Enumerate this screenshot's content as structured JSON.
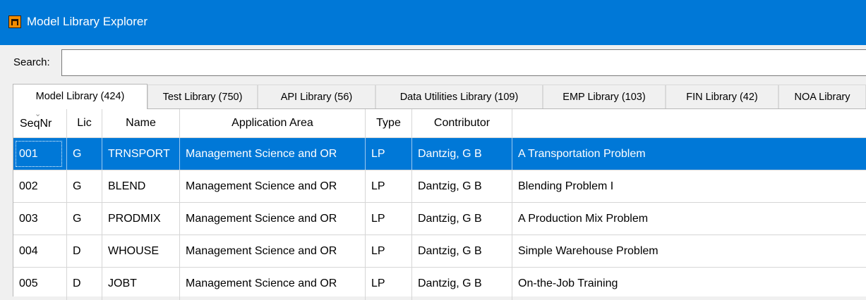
{
  "window": {
    "title": "Model Library Explorer"
  },
  "search": {
    "label": "Search:",
    "value": "",
    "placeholder": ""
  },
  "tabs": [
    {
      "label": "Model Library (424)",
      "active": true
    },
    {
      "label": "Test Library (750)",
      "active": false
    },
    {
      "label": "API Library (56)",
      "active": false
    },
    {
      "label": "Data Utilities Library (109)",
      "active": false
    },
    {
      "label": "EMP Library (103)",
      "active": false
    },
    {
      "label": "FIN Library (42)",
      "active": false
    },
    {
      "label": "NOA Library",
      "active": false
    }
  ],
  "table": {
    "sort_indicator": "chevron-down-icon",
    "columns": [
      "SeqNr",
      "Lic",
      "Name",
      "Application Area",
      "Type",
      "Contributor",
      ""
    ],
    "rows": [
      {
        "seqnr": "001",
        "lic": "G",
        "name": "TRNSPORT",
        "area": "Management Science and OR",
        "type": "LP",
        "contributor": "Dantzig, G B",
        "description": "A Transportation Problem",
        "selected": true
      },
      {
        "seqnr": "002",
        "lic": "G",
        "name": "BLEND",
        "area": "Management Science and OR",
        "type": "LP",
        "contributor": "Dantzig, G B",
        "description": "Blending Problem I",
        "selected": false
      },
      {
        "seqnr": "003",
        "lic": "G",
        "name": "PRODMIX",
        "area": "Management Science and OR",
        "type": "LP",
        "contributor": "Dantzig, G B",
        "description": "A Production Mix Problem",
        "selected": false
      },
      {
        "seqnr": "004",
        "lic": "D",
        "name": "WHOUSE",
        "area": "Management Science and OR",
        "type": "LP",
        "contributor": "Dantzig, G B",
        "description": "Simple Warehouse Problem",
        "selected": false
      },
      {
        "seqnr": "005",
        "lic": "D",
        "name": "JOBT",
        "area": "Management Science and OR",
        "type": "LP",
        "contributor": "Dantzig, G B",
        "description": "On-the-Job Training",
        "selected": false
      }
    ]
  },
  "colors": {
    "titlebar": "#0078d7",
    "selection": "#0078d7",
    "window_bg": "#f0f0f0"
  }
}
